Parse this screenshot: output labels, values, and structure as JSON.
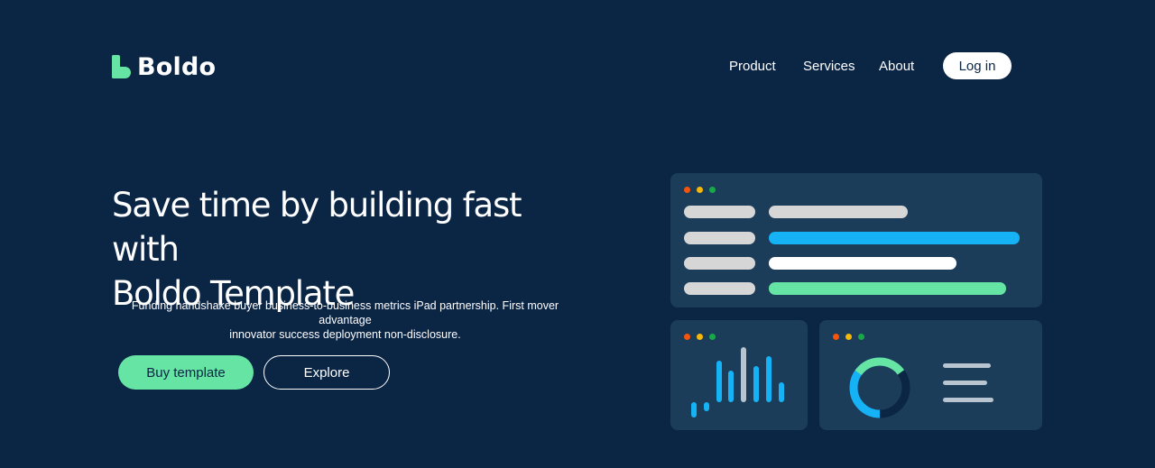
{
  "header": {
    "brand": "Boldo",
    "nav": [
      {
        "label": "Product"
      },
      {
        "label": "Services"
      },
      {
        "label": "About"
      }
    ],
    "login_label": "Log in"
  },
  "hero": {
    "title_line1": "Save time by building fast with",
    "title_line2": "Boldo Template",
    "subtitle_line1": "Funding handshake buyer business-to-business metrics iPad partnership. First mover advantage",
    "subtitle_line2": "innovator success deployment non-disclosure.",
    "primary_cta": "Buy template",
    "secondary_cta": "Explore"
  },
  "illustration": {
    "window_dot_colors": [
      "#f6540b",
      "#f5b70a",
      "#18a84a"
    ],
    "colors": {
      "card": "#1c3d5a",
      "grey_bar": "#d6d6d6",
      "blue": "#15b3f5",
      "white": "#ffffff",
      "green": "#65e4a3",
      "lines": "#b8c4cf"
    },
    "progress_rows": [
      {
        "label_color": "grey",
        "bar_color": "grey",
        "fill": 0.55
      },
      {
        "label_color": "grey",
        "bar_color": "blue",
        "fill": 1.0
      },
      {
        "label_color": "grey",
        "bar_color": "white",
        "fill": 0.75
      },
      {
        "label_color": "grey",
        "bar_color": "green",
        "fill": 0.95
      }
    ],
    "bar_chart_values": [
      0.2,
      0.15,
      0.7,
      0.55,
      1.0,
      0.6,
      0.8,
      0.35
    ],
    "donut": {
      "blue_fraction": 0.55,
      "green_fraction": 0.3
    }
  }
}
